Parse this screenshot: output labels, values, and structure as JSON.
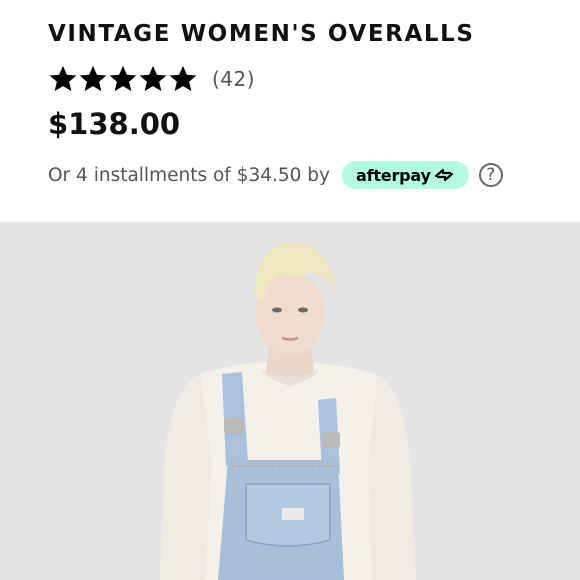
{
  "product": {
    "title": "VINTAGE WOMEN'S OVERALLS",
    "rating": 5,
    "rating_max": 5,
    "review_count": "(42)",
    "price": "$138.00",
    "installments_text": "Or 4 installments of $34.50 by",
    "afterpay_label": "afterpay"
  },
  "icons": {
    "star": "star-icon",
    "help": "question-mark-circle-icon",
    "afterpay_arrows": "afterpay-arrows-icon"
  },
  "colors": {
    "afterpay_badge": "#b2fce4",
    "image_background": "#e6e6e6",
    "text_primary": "#111111",
    "text_secondary": "#555555"
  },
  "help_glyph": "?"
}
